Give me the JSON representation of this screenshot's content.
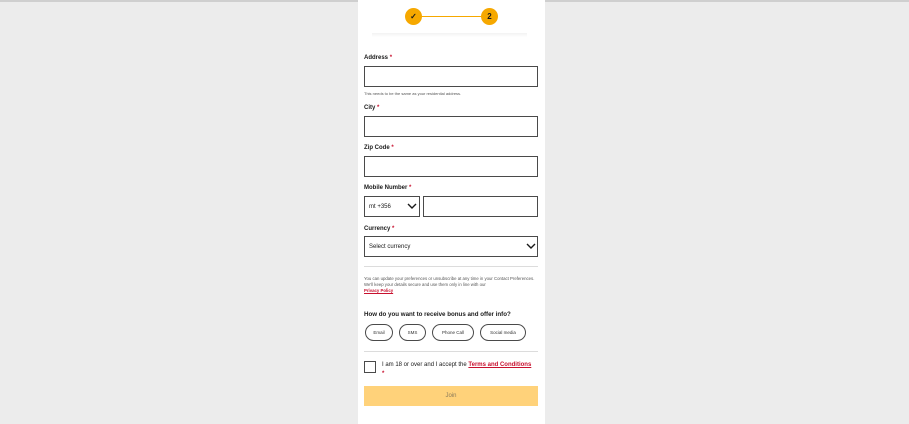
{
  "stepper": {
    "step1_glyph": "✓",
    "step2_label": "2"
  },
  "form": {
    "address": {
      "label": "Address",
      "required_mark": "*",
      "value": "",
      "hint": "This needs to be the same as your residential address."
    },
    "city": {
      "label": "City",
      "required_mark": "*",
      "value": ""
    },
    "zip": {
      "label": "Zip Code",
      "required_mark": "*",
      "value": ""
    },
    "mobile": {
      "label": "Mobile Number",
      "required_mark": "*",
      "country_code": "mt +356",
      "value": ""
    },
    "currency": {
      "label": "Currency",
      "required_mark": "*",
      "placeholder": "Select currency"
    }
  },
  "preferences": {
    "note": "You can update your preferences or unsubscribe at any time in your Contact Preferences. We'll keep your details secure and use them only in line with our",
    "privacy_link": "Privacy Policy",
    "question": "How do you want to receive bonus and offer info?",
    "options": [
      "Email",
      "SMS",
      "Phone Call",
      "Social media"
    ]
  },
  "terms": {
    "text": "I am 18 or over and I accept the",
    "link": "Terms and Conditions",
    "required_mark": "*"
  },
  "join_button": {
    "label": "Join"
  },
  "colors": {
    "accent": "#f6a800",
    "link": "#c8102e",
    "button_disabled": "#ffd27a"
  }
}
